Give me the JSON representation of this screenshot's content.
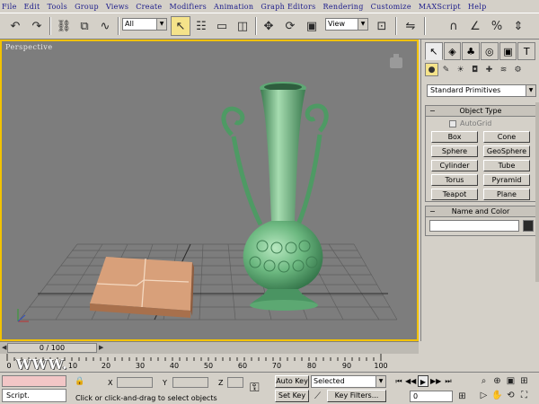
{
  "menu": [
    "File",
    "Edit",
    "Tools",
    "Group",
    "Views",
    "Create",
    "Modifiers",
    "Animation",
    "Graph Editors",
    "Rendering",
    "Customize",
    "MAXScript",
    "Help"
  ],
  "toolbar": {
    "selection_filter": "All",
    "reference_coord": "View",
    "icons": [
      "undo-icon",
      "redo-icon",
      "link-icon",
      "unlink-icon",
      "bind-space-warp-icon",
      "select-object-icon",
      "select-by-name-icon",
      "rectangular-selection-icon",
      "window-crossing-icon",
      "move-icon",
      "rotate-icon",
      "scale-icon",
      "pivot-icon",
      "snap-icon",
      "angle-snap-icon",
      "percent-snap-icon",
      "spinner-snap-icon"
    ]
  },
  "viewport": {
    "label": "Perspective",
    "accent": "#f2c200",
    "background": "#7d7d7d"
  },
  "command_panel": {
    "tabs": [
      "create-tab-icon",
      "modify-tab-icon",
      "hierarchy-tab-icon",
      "motion-tab-icon",
      "display-tab-icon",
      "utilities-tab-icon"
    ],
    "category": "Standard Primitives",
    "object_type": {
      "title": "Object Type",
      "autogrid": "AutoGrid",
      "buttons": [
        "Box",
        "Cone",
        "Sphere",
        "GeoSphere",
        "Cylinder",
        "Tube",
        "Torus",
        "Pyramid",
        "Teapot",
        "Plane"
      ]
    },
    "name_color": {
      "title": "Name and Color",
      "swatch": "#2a2a2a"
    }
  },
  "time_slider": {
    "position": "0 / 100"
  },
  "trackbar": {
    "ticks": [
      "0",
      "10",
      "20",
      "30",
      "40",
      "50",
      "60",
      "70",
      "80",
      "90",
      "100"
    ],
    "watermark": "WWW."
  },
  "status": {
    "script_label": "Script.",
    "x_label": "X",
    "y_label": "Y",
    "z_label": "Z",
    "message": "Click or click-and-drag to select objects",
    "auto_key": "Auto Key",
    "set_key": "Set Key",
    "selected": "Selected",
    "key_filters": "Key Filters...",
    "frame": "0"
  }
}
